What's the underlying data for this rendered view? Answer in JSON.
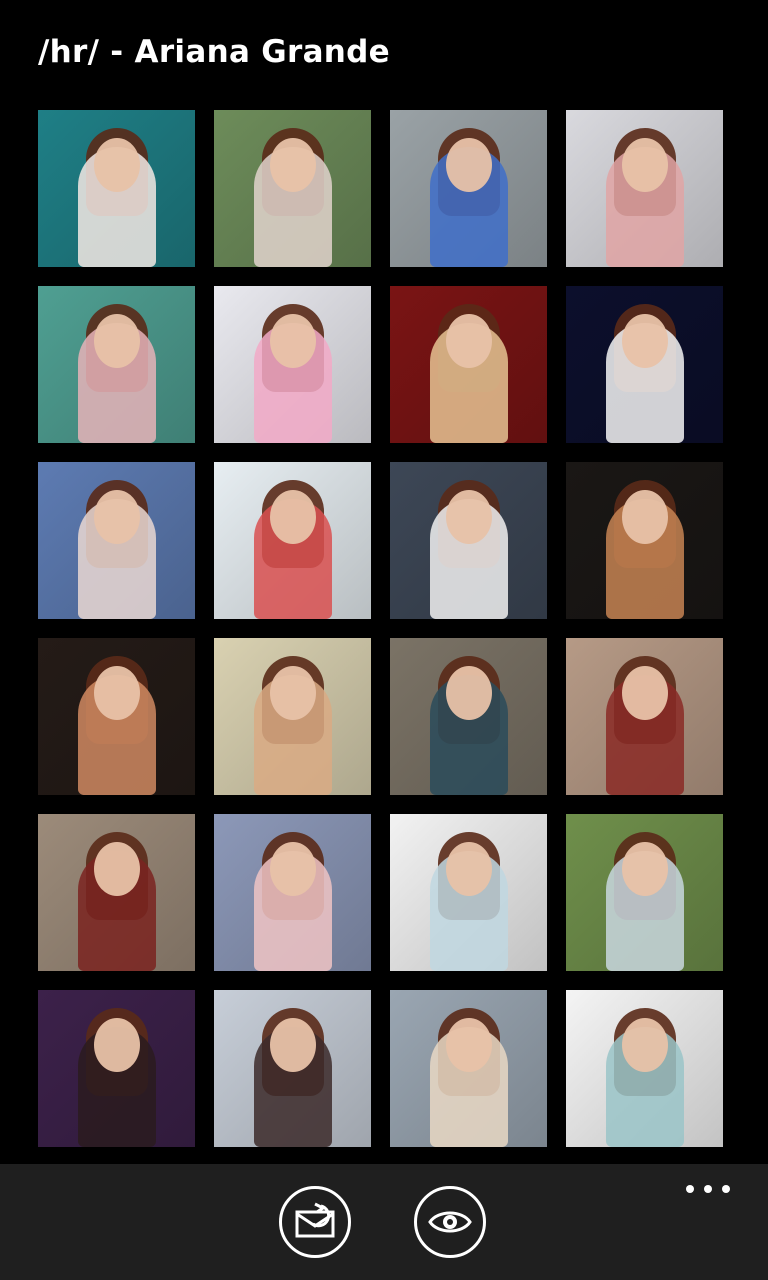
{
  "header": {
    "title": "/hr/ - Ariana Grande"
  },
  "thumbnails": [
    {
      "bg": "#1f7f86",
      "accent": "#f3e9e4"
    },
    {
      "bg": "#6d8c5a",
      "accent": "#e2d4cc"
    },
    {
      "bg": "#9aa2a6",
      "accent": "#3f6fc9"
    },
    {
      "bg": "#d9d9de",
      "accent": "#e0a4a4"
    },
    {
      "bg": "#4f9f92",
      "accent": "#e6b3b8"
    },
    {
      "bg": "#e9e9ef",
      "accent": "#f2a9c7"
    },
    {
      "bg": "#7a1414",
      "accent": "#e6c393"
    },
    {
      "bg": "#0c0f2c",
      "accent": "#f4f4f4"
    },
    {
      "bg": "#5d7bb2",
      "accent": "#ead8d2"
    },
    {
      "bg": "#e7eef2",
      "accent": "#d95050"
    },
    {
      "bg": "#3d4756",
      "accent": "#f1f1f1"
    },
    {
      "bg": "#1a1715",
      "accent": "#c78454"
    },
    {
      "bg": "#241b17",
      "accent": "#d08a62"
    },
    {
      "bg": "#d9d1b1",
      "accent": "#d9aa84"
    },
    {
      "bg": "#7b7366",
      "accent": "#2a4b5a"
    },
    {
      "bg": "#b69a86",
      "accent": "#8a2a26"
    },
    {
      "bg": "#9c8b7a",
      "accent": "#7a2320"
    },
    {
      "bg": "#8c98b8",
      "accent": "#f0c4c4"
    },
    {
      "bg": "#f2f2f2",
      "accent": "#bfd7e0"
    },
    {
      "bg": "#6f8f4b",
      "accent": "#c9d7df"
    },
    {
      "bg": "#3c214a",
      "accent": "#2a1b1f"
    },
    {
      "bg": "#c7ced8",
      "accent": "#3c2a2a"
    },
    {
      "bg": "#9aa6b2",
      "accent": "#e9d8c4"
    },
    {
      "bg": "#f4f4f4",
      "accent": "#9ac4c8"
    }
  ],
  "appbar": {
    "reply_icon": "reply-icon",
    "view_icon": "eye-icon",
    "more_icon": "ellipsis-icon"
  }
}
